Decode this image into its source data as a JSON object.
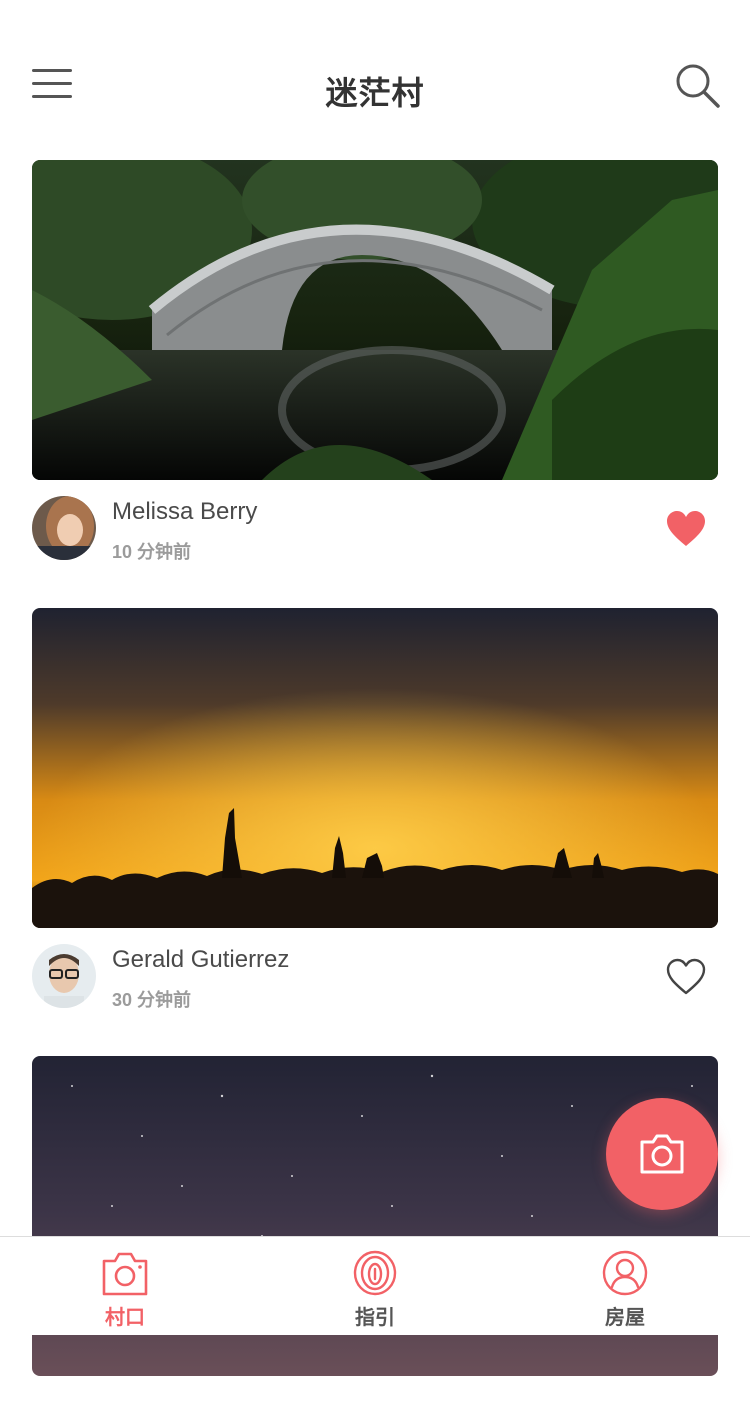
{
  "header": {
    "title": "迷茫村",
    "menu_icon": "menu-icon",
    "search_icon": "search-icon"
  },
  "feed": {
    "posts": [
      {
        "image": "stone-arch-bridge-garden-photo",
        "author": "Melissa Berry",
        "time": "10 分钟前",
        "liked": true
      },
      {
        "image": "penguins-sunset-photo",
        "author": "Gerald Gutierrez",
        "time": "30 分钟前",
        "liked": false
      },
      {
        "image": "starry-night-sky-photo"
      }
    ]
  },
  "fab": {
    "icon": "camera-icon"
  },
  "tabbar": {
    "tabs": [
      {
        "label": "村口",
        "icon": "camera-icon",
        "active": true
      },
      {
        "label": "指引",
        "icon": "fingerprint-icon",
        "active": false
      },
      {
        "label": "房屋",
        "icon": "profile-icon",
        "active": false
      }
    ]
  },
  "colors": {
    "accent": "#f26166",
    "text_primary": "#333333",
    "text_secondary": "#9b9b9b",
    "tab_inactive": "#555555"
  }
}
